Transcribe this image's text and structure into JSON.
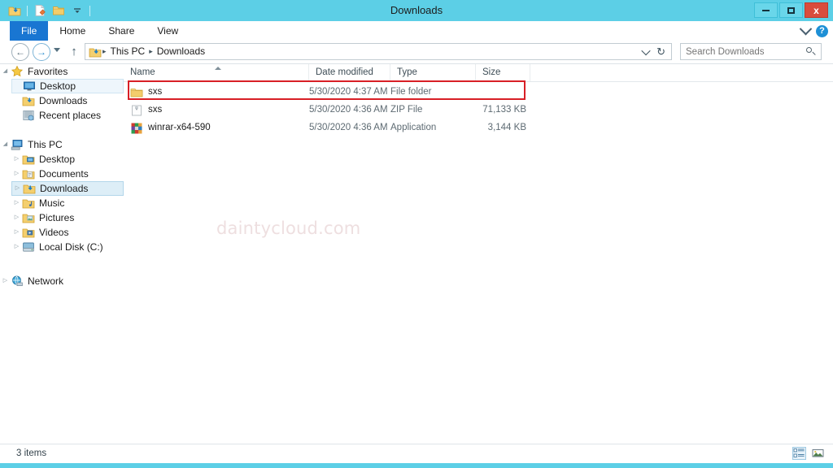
{
  "window": {
    "title": "Downloads",
    "accent_color": "#5ccfe6",
    "close_button_color": "#d94c3d",
    "controls": {
      "minimize_label": "Minimize",
      "maximize_label": "Maximize",
      "close_label": "x"
    }
  },
  "quick_access_toolbar": {
    "items": [
      {
        "name": "downloads-folder-icon",
        "label": "Downloads"
      },
      {
        "name": "properties-icon",
        "label": "Properties"
      },
      {
        "name": "new-folder-icon",
        "label": "New folder"
      },
      {
        "name": "customize-dropdown-icon",
        "label": "Customize Quick Access Toolbar"
      }
    ]
  },
  "ribbon": {
    "tabs": [
      {
        "label": "File",
        "active": true
      },
      {
        "label": "Home",
        "active": false
      },
      {
        "label": "Share",
        "active": false
      },
      {
        "label": "View",
        "active": false
      }
    ],
    "minimize_ribbon_label": "Minimize the Ribbon",
    "help_label": "?"
  },
  "navigation": {
    "back_label": "←",
    "forward_label": "→",
    "recent_label": "Recent locations",
    "up_label": "↑",
    "breadcrumbs": [
      {
        "label": "This PC"
      },
      {
        "label": "Downloads"
      }
    ],
    "breadcrumb_separator": "▸",
    "previous_locations_label": "Previous locations",
    "refresh_label": "↻"
  },
  "search": {
    "placeholder": "Search Downloads",
    "value": "",
    "icon": "search-icon"
  },
  "sidebar": {
    "groups": [
      {
        "name": "favorites",
        "header": {
          "label": "Favorites",
          "icon": "star-icon",
          "expanded": true
        },
        "items": [
          {
            "label": "Desktop",
            "icon": "desktop-icon",
            "state": "hovered"
          },
          {
            "label": "Downloads",
            "icon": "downloads-icon",
            "state": "normal"
          },
          {
            "label": "Recent places",
            "icon": "recent-places-icon",
            "state": "normal"
          }
        ]
      },
      {
        "name": "this-pc",
        "header": {
          "label": "This PC",
          "icon": "computer-icon",
          "expanded": true
        },
        "items": [
          {
            "label": "Desktop",
            "icon": "desktop-folder-icon",
            "state": "normal"
          },
          {
            "label": "Documents",
            "icon": "documents-folder-icon",
            "state": "normal"
          },
          {
            "label": "Downloads",
            "icon": "downloads-folder-icon",
            "state": "selected"
          },
          {
            "label": "Music",
            "icon": "music-folder-icon",
            "state": "normal"
          },
          {
            "label": "Pictures",
            "icon": "pictures-folder-icon",
            "state": "normal"
          },
          {
            "label": "Videos",
            "icon": "videos-folder-icon",
            "state": "normal"
          },
          {
            "label": "Local Disk (C:)",
            "icon": "disk-drive-icon",
            "state": "normal"
          }
        ]
      },
      {
        "name": "network",
        "header": {
          "label": "Network",
          "icon": "network-icon",
          "expanded": false
        },
        "items": []
      }
    ]
  },
  "file_list": {
    "columns": [
      {
        "key": "name",
        "label": "Name",
        "sorted": "asc"
      },
      {
        "key": "date",
        "label": "Date modified",
        "sorted": null
      },
      {
        "key": "type",
        "label": "Type",
        "sorted": null
      },
      {
        "key": "size",
        "label": "Size",
        "sorted": null
      }
    ],
    "rows": [
      {
        "name": "sxs",
        "date": "5/30/2020 4:37 AM",
        "type": "File folder",
        "size": "",
        "icon": "folder-icon",
        "highlighted": true
      },
      {
        "name": "sxs",
        "date": "5/30/2020 4:36 AM",
        "type": "ZIP File",
        "size": "71,133 KB",
        "icon": "zip-file-icon",
        "highlighted": false
      },
      {
        "name": "winrar-x64-590",
        "date": "5/30/2020 4:36 AM",
        "type": "Application",
        "size": "3,144 KB",
        "icon": "winrar-app-icon",
        "highlighted": false
      }
    ],
    "annotation": {
      "shape": "rectangle",
      "color": "#d81f26",
      "target_row": 0
    }
  },
  "watermark": {
    "text": "daintycloud.com",
    "color": "#eedfe0"
  },
  "status_bar": {
    "item_count_text": "3 items",
    "view_buttons": [
      {
        "name": "details-view-button",
        "label": "Details view",
        "active": true
      },
      {
        "name": "large-icons-view-button",
        "label": "Large icons view",
        "active": false
      }
    ]
  }
}
